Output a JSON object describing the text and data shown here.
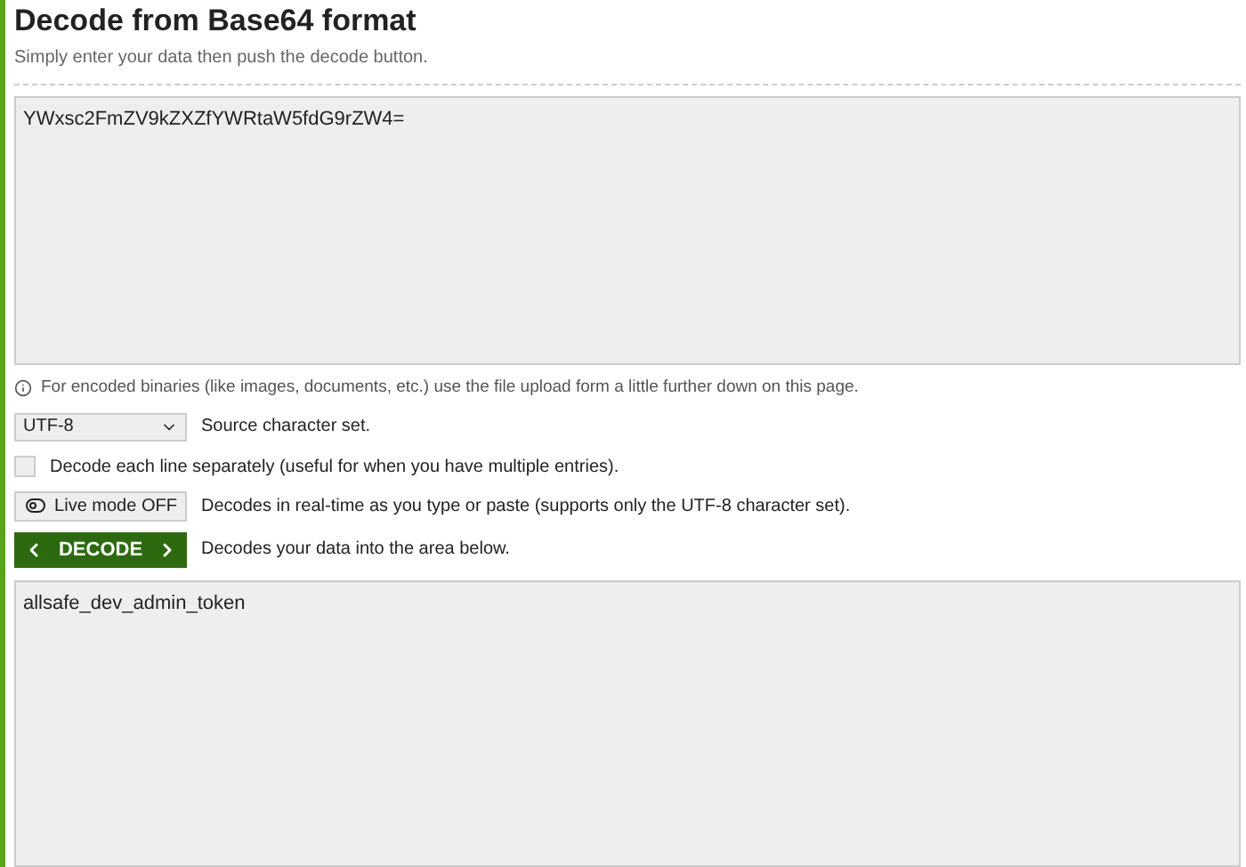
{
  "title": "Decode from Base64 format",
  "subtitle": "Simply enter your data then push the decode button.",
  "input": {
    "value": "YWxsc2FmZV9kZXZfYWRtaW5fdG9rZW4="
  },
  "info": "For encoded binaries (like images, documents, etc.) use the file upload form a little further down on this page.",
  "charset": {
    "value": "UTF-8",
    "label": "Source character set."
  },
  "separate_lines": {
    "checked": false,
    "label": "Decode each line separately (useful for when you have multiple entries)."
  },
  "live_mode": {
    "on": false,
    "button": "Live mode OFF",
    "label": "Decodes in real-time as you type or paste (supports only the UTF-8 character set)."
  },
  "decode": {
    "button": "DECODE",
    "label": "Decodes your data into the area below."
  },
  "output": {
    "value": "allsafe_dev_admin_token"
  }
}
